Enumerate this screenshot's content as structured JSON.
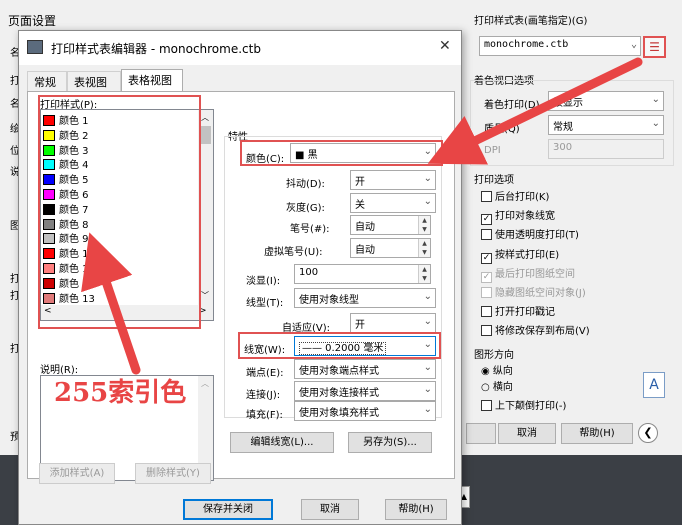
{
  "bg": {
    "page_setup_title": "页面设置",
    "plot_style_table_label": "打印样式表(画笔指定)(G)",
    "plot_style_table_value": "monochrome.ctb",
    "shaded_viewport_title": "着色视口选项",
    "shade_plot_label": "着色打印(D)",
    "shade_plot_value": "按显示",
    "quality_label": "质量(Q)",
    "quality_value": "常规",
    "dpi_label": "DPI",
    "dpi_value": "300",
    "plot_options_title": "打印选项",
    "options": [
      {
        "label": "后台打印(K)",
        "checked": false,
        "enabled": true
      },
      {
        "label": "打印对象线宽",
        "checked": true,
        "enabled": true
      },
      {
        "label": "使用透明度打印(T)",
        "checked": false,
        "enabled": true
      },
      {
        "label": "按样式打印(E)",
        "checked": true,
        "enabled": true
      },
      {
        "label": "最后打印图纸空间",
        "checked": true,
        "enabled": false
      },
      {
        "label": "隐藏图纸空间对象(J)",
        "checked": false,
        "enabled": false
      },
      {
        "label": "打开打印戳记",
        "checked": false,
        "enabled": true
      },
      {
        "label": "将修改保存到布局(V)",
        "checked": false,
        "enabled": true
      }
    ],
    "orientation_title": "图形方向",
    "portrait_label": "纵向",
    "landscape_label": "横向",
    "upside_down_label": "上下颠倒打印(-)",
    "cancel_label": "取消",
    "help_label": "帮助(H)",
    "left_letters": [
      "名",
      "打",
      "名",
      "绘",
      "位",
      "说",
      "图",
      "打",
      "打",
      "打",
      "预"
    ]
  },
  "editor": {
    "title": "打印样式表编辑器 - monochrome.ctb",
    "close_glyph": "✕",
    "tabs": [
      "常规",
      "表视图",
      "表格视图"
    ],
    "styles_label": "打印样式(P):",
    "styles": [
      {
        "name": "颜色 1",
        "color": "#ff0000"
      },
      {
        "name": "颜色 2",
        "color": "#ffff00"
      },
      {
        "name": "颜色 3",
        "color": "#00ff00"
      },
      {
        "name": "颜色 4",
        "color": "#00ffff"
      },
      {
        "name": "颜色 5",
        "color": "#0000ff"
      },
      {
        "name": "颜色 6",
        "color": "#ff00ff"
      },
      {
        "name": "颜色 7",
        "color": "#000000"
      },
      {
        "name": "颜色 8",
        "color": "#808080"
      },
      {
        "name": "颜色 9",
        "color": "#c0c0c0"
      },
      {
        "name": "颜色 10",
        "color": "#ff0000"
      },
      {
        "name": "颜色 11",
        "color": "#ff7f7f"
      },
      {
        "name": "颜色 12",
        "color": "#cc0000"
      },
      {
        "name": "颜色 13",
        "color": "#e07a7a"
      }
    ],
    "description_label": "说明(R):",
    "add_style_label": "添加样式(A)",
    "delete_style_label": "删除样式(Y)",
    "properties_label": "特性",
    "color_label": "颜色(C):",
    "color_value": "■ 黑",
    "dither_label": "抖动(D):",
    "dither_value": "开",
    "grayscale_label": "灰度(G):",
    "grayscale_value": "关",
    "pen_label": "笔号(#):",
    "pen_value": "自动",
    "virtual_pen_label": "虚拟笔号(U):",
    "virtual_pen_value": "自动",
    "screening_label": "淡显(I):",
    "screening_value": "100",
    "linetype_label": "线型(T):",
    "linetype_value": "使用对象线型",
    "adaptive_label": "自适应(V):",
    "adaptive_value": "开",
    "lineweight_label": "线宽(W):",
    "lineweight_value": "—— 0.2000 毫米",
    "endstyle_label": "端点(E):",
    "endstyle_value": "使用对象端点样式",
    "joinstyle_label": "连接(J):",
    "joinstyle_value": "使用对象连接样式",
    "fill_label": "填充(F):",
    "fill_value": "使用对象填充样式",
    "edit_lineweights_label": "编辑线宽(L)...",
    "save_as_label": "另存为(S)...",
    "save_close_label": "保存并关闭",
    "cancel_label": "取消",
    "help_label": "帮助(H)"
  },
  "annotation": {
    "text": "255索引色",
    "color": "#e84545"
  },
  "colors": {
    "highlight_red": "#e05252",
    "accent_blue": "#0078d7"
  }
}
